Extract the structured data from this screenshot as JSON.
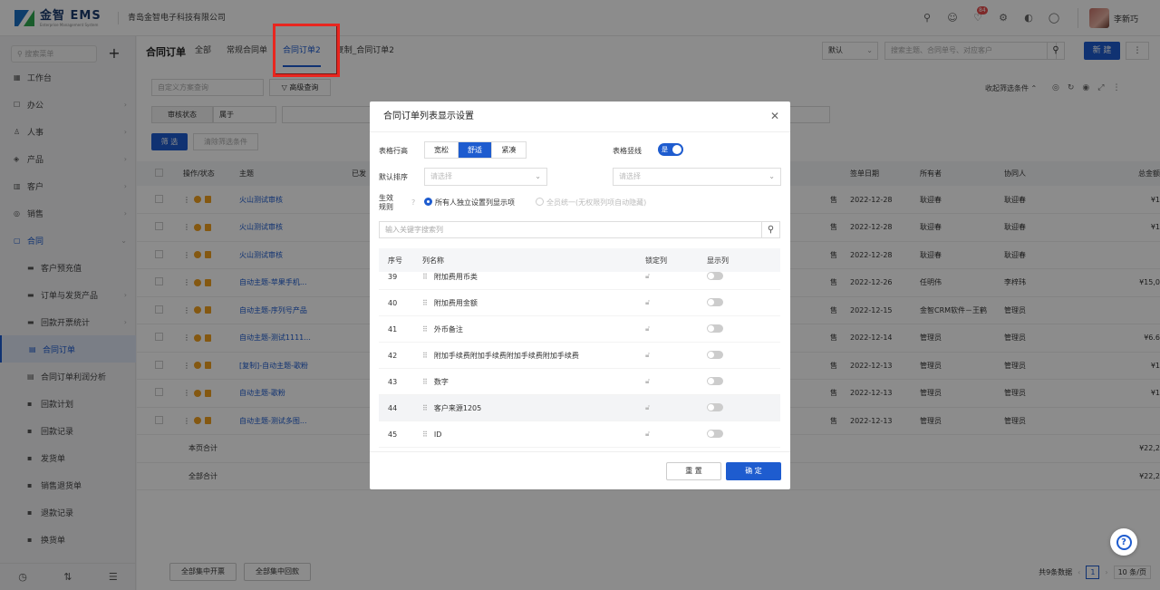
{
  "brand": {
    "name": "金智 EMS",
    "sub": "Enterprise Management System",
    "company": "青岛金智电子科技有限公司",
    "color": "#1a3b6e"
  },
  "header": {
    "notif_count": "84",
    "user": "李新巧"
  },
  "sidebar": {
    "search_placeholder": "搜索菜单",
    "items": [
      {
        "label": "工作台",
        "icon": "dashboard-icon",
        "arrow": false
      },
      {
        "label": "办公",
        "icon": "office-icon",
        "arrow": true
      },
      {
        "label": "人事",
        "icon": "people-icon",
        "arrow": true
      },
      {
        "label": "产品",
        "icon": "product-icon",
        "arrow": true
      },
      {
        "label": "客户",
        "icon": "customer-icon",
        "arrow": true
      },
      {
        "label": "销售",
        "icon": "sales-icon",
        "arrow": true
      },
      {
        "label": "合同",
        "icon": "contract-icon",
        "arrow": true
      }
    ],
    "subitems": [
      "客户预充值",
      "订单与发货产品",
      "回款开票统计",
      "合同订单",
      "合同订单利润分析",
      "回款计划",
      "回款记录",
      "发货单",
      "销售退货单",
      "退款记录",
      "换货单"
    ],
    "active": "合同订单"
  },
  "tabs": {
    "heading": "合同订单",
    "items": [
      "全部",
      "常规合同单",
      "合同订单2",
      "复制_合同订单2"
    ],
    "active": "合同订单2"
  },
  "toolbar": {
    "sort": "默认",
    "search_placeholder": "搜索主题、合同单号、对应客户",
    "new": "新 建"
  },
  "filters": {
    "custom_placeholder": "自定义方案查询",
    "advanced": "高级查询",
    "field": "审核状态",
    "op": "属于",
    "filter_btn": "筛 选",
    "clear_btn": "清除筛选条件",
    "collapse": "收起筛选条件"
  },
  "grid": {
    "headers": [
      "",
      "操作/状态",
      "主题",
      "已发",
      "",
      "签单日期",
      "所有者",
      "协同人",
      "总金额"
    ],
    "rows": [
      {
        "subject": "火山测试审核",
        "date": "2022-12-28",
        "owner": "耿迎春",
        "co": "耿迎春",
        "amount": "¥1",
        "side": "售"
      },
      {
        "subject": "火山测试审核",
        "date": "2022-12-28",
        "owner": "耿迎春",
        "co": "耿迎春",
        "amount": "¥1",
        "side": "售"
      },
      {
        "subject": "火山测试审核",
        "date": "2022-12-28",
        "owner": "耿迎春",
        "co": "耿迎春",
        "amount": "",
        "side": "售"
      },
      {
        "subject": "自动主题-苹果手机...",
        "date": "2022-12-26",
        "owner": "任明伟",
        "co": "李梓玮",
        "amount": "¥15,0",
        "side": "售"
      },
      {
        "subject": "自动主题-序列号产品",
        "date": "2022-12-15",
        "owner": "金智CRM软件－王鹤",
        "co": "管理员",
        "amount": "",
        "side": "售"
      },
      {
        "subject": "自动主题-测试1111...",
        "date": "2022-12-14",
        "owner": "管理员",
        "co": "管理员",
        "amount": "¥6.6",
        "side": "售"
      },
      {
        "subject": "[复制]-自动主题-歌粉",
        "date": "2022-12-13",
        "owner": "管理员",
        "co": "管理员",
        "amount": "¥1",
        "side": "售"
      },
      {
        "subject": "自动主题-歌粉",
        "date": "2022-12-13",
        "owner": "管理员",
        "co": "管理员",
        "amount": "¥1",
        "side": "售"
      },
      {
        "subject": "自动主题-测试多图...",
        "date": "2022-12-13",
        "owner": "管理员",
        "co": "管理员",
        "amount": "",
        "side": "售"
      }
    ],
    "page_total_label": "本页合计",
    "page_total": "¥22,2",
    "all_total_label": "全部合计",
    "all_total": "¥22,2"
  },
  "footer": {
    "btn1": "全部集中开票",
    "btn2": "全部集中回款",
    "count": "共9条数据",
    "page": "1",
    "per_page": "10 条/页"
  },
  "modal": {
    "title": "合同订单列表显示设置",
    "row_height_label": "表格行高",
    "row_heights": [
      "宽松",
      "舒适",
      "紧凑"
    ],
    "row_height_selected": "舒适",
    "border_label": "表格竖线",
    "border_value": "是",
    "sort_label": "默认排序",
    "sort_placeholder": "请选择",
    "sort2_placeholder": "请选择",
    "rule_label": "生效规则",
    "rule_opt1": "所有人独立设置列显示项",
    "rule_opt2": "全员统一(无权限列项自动隐藏)",
    "search_placeholder": "输入关键字搜索列",
    "cols": [
      "序号",
      "列名称",
      "锁定列",
      "显示列"
    ],
    "rows": [
      {
        "no": "39",
        "name": "附加费用币类"
      },
      {
        "no": "40",
        "name": "附加费用金额"
      },
      {
        "no": "41",
        "name": "外币备注"
      },
      {
        "no": "42",
        "name": "附加手续费附加手续费附加手续费附加手续费"
      },
      {
        "no": "43",
        "name": "数字"
      },
      {
        "no": "44",
        "name": "客户来源1205"
      },
      {
        "no": "45",
        "name": "ID"
      }
    ],
    "reset": "重 置",
    "ok": "确 定"
  }
}
